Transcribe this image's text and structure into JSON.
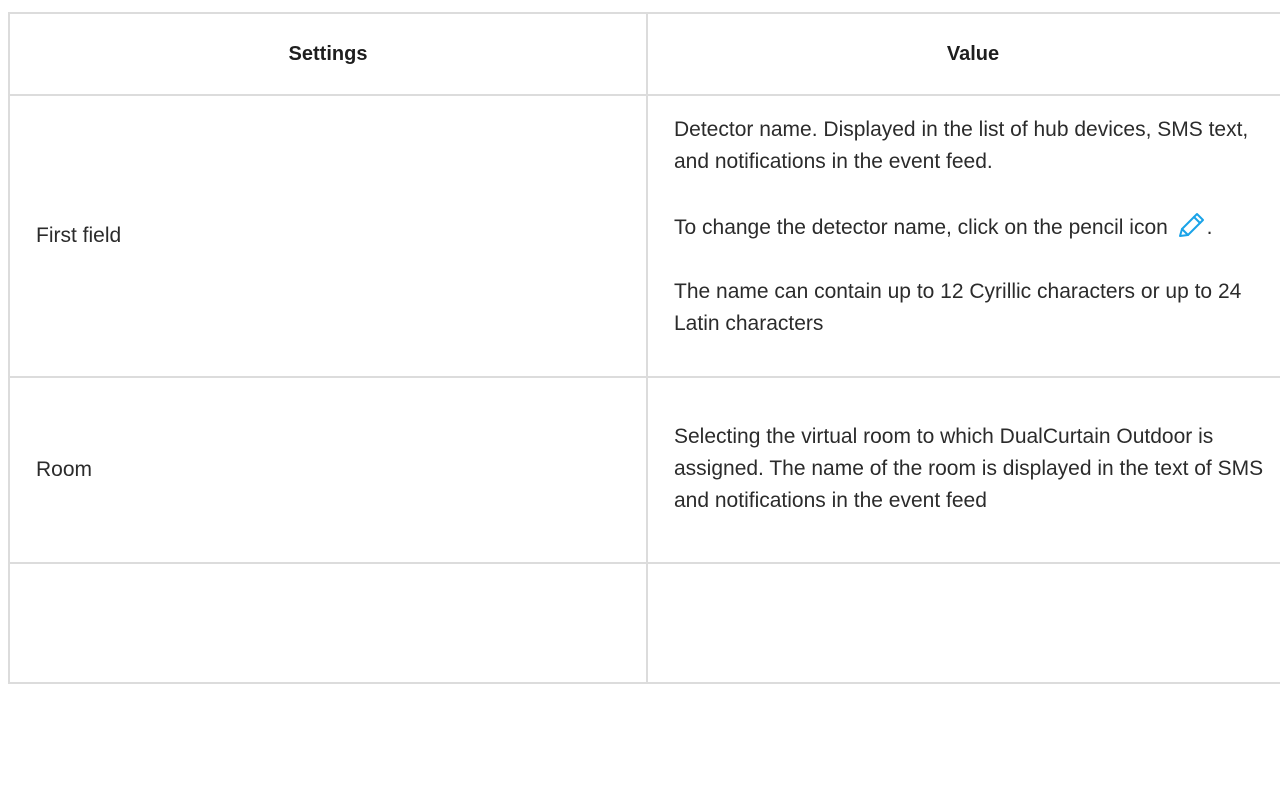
{
  "table": {
    "headers": [
      "Settings",
      "Value"
    ],
    "rows": [
      {
        "setting": "First field",
        "value_paragraphs": [
          "Detector name. Displayed in the list of hub devices, SMS text, and notifications in the event feed.",
          "To change the detector name, click on the pencil icon",
          "The name can contain up to 12 Cyrillic characters or up to 24 Latin characters"
        ],
        "icon": "pencil-icon",
        "after_icon": "."
      },
      {
        "setting": "Room",
        "value": "Selecting the virtual room to which DualCurtain Outdoor is assigned. The name of the room is displayed in the text of SMS and notifications in the event feed"
      },
      {
        "setting": "",
        "value": ""
      }
    ]
  },
  "colors": {
    "border": "#dcdcdc",
    "text": "#2b2b2b",
    "icon": "#1aa3e8"
  }
}
